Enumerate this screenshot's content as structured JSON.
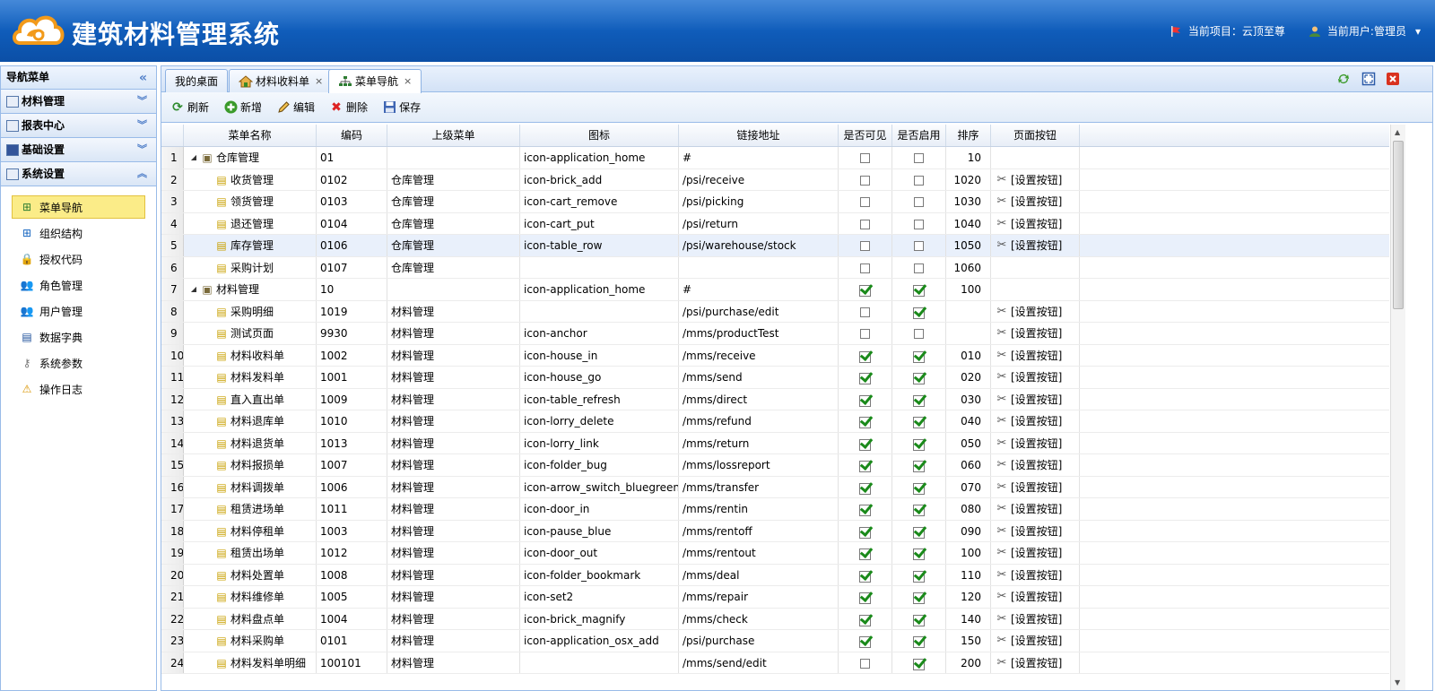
{
  "header": {
    "title": "建筑材料管理系统",
    "project_label": "当前项目：云顶至尊",
    "user_label": "当前用户:管理员",
    "user_dropdown": "▾"
  },
  "sidebar": {
    "title": "导航菜单",
    "collapse_glyph": "«",
    "groups": [
      {
        "label": "材料管理",
        "chevron": "︾"
      },
      {
        "label": "报表中心",
        "chevron": "︾"
      },
      {
        "label": "基础设置",
        "chevron": "︾"
      },
      {
        "label": "系统设置",
        "chevron": "︽"
      }
    ],
    "items": [
      {
        "label": "菜单导航",
        "icon": "sitemap-icon",
        "glyph": "⊞",
        "color": "#2e7d32"
      },
      {
        "label": "组织结构",
        "icon": "org-icon",
        "glyph": "⊞",
        "color": "#1565c0"
      },
      {
        "label": "授权代码",
        "icon": "lock-icon",
        "glyph": "🔒",
        "color": "#c28b00"
      },
      {
        "label": "角色管理",
        "icon": "role-icon",
        "glyph": "👥",
        "color": "#b04a00"
      },
      {
        "label": "用户管理",
        "icon": "users-icon",
        "glyph": "👥",
        "color": "#b04a00"
      },
      {
        "label": "数据字典",
        "icon": "book-icon",
        "glyph": "▤",
        "color": "#1a4d99"
      },
      {
        "label": "系统参数",
        "icon": "key-icon",
        "glyph": "⚷",
        "color": "#777"
      },
      {
        "label": "操作日志",
        "icon": "warning-icon",
        "glyph": "⚠",
        "color": "#d99400"
      }
    ]
  },
  "tabs": [
    {
      "label": "我的桌面",
      "closable": false
    },
    {
      "label": "材料收料单",
      "closable": true
    },
    {
      "label": "菜单导航",
      "closable": true
    }
  ],
  "tab_close_glyph": "×",
  "toolbar": {
    "refresh": "刷新",
    "add": "新增",
    "edit": "编辑",
    "delete": "删除",
    "save": "保存"
  },
  "grid": {
    "columns": [
      "菜单名称",
      "编码",
      "上级菜单",
      "图标",
      "链接地址",
      "是否可见",
      "是否启用",
      "排序",
      "页面按钮"
    ],
    "set_button_label": "[设置按钮]",
    "rows": [
      {
        "n": "1",
        "name": "仓库管理",
        "code": "01",
        "parent": "",
        "icon": "icon-application_home",
        "url": "#",
        "visible": false,
        "enabled": false,
        "sort": "10",
        "btn": false,
        "level": 0
      },
      {
        "n": "2",
        "name": "收货管理",
        "code": "0102",
        "parent": "仓库管理",
        "icon": "icon-brick_add",
        "url": "/psi/receive",
        "visible": false,
        "enabled": false,
        "sort": "1020",
        "btn": true,
        "level": 1
      },
      {
        "n": "3",
        "name": "领货管理",
        "code": "0103",
        "parent": "仓库管理",
        "icon": "icon-cart_remove",
        "url": "/psi/picking",
        "visible": false,
        "enabled": false,
        "sort": "1030",
        "btn": true,
        "level": 1
      },
      {
        "n": "4",
        "name": "退还管理",
        "code": "0104",
        "parent": "仓库管理",
        "icon": "icon-cart_put",
        "url": "/psi/return",
        "visible": false,
        "enabled": false,
        "sort": "1040",
        "btn": true,
        "level": 1
      },
      {
        "n": "5",
        "name": "库存管理",
        "code": "0106",
        "parent": "仓库管理",
        "icon": "icon-table_row",
        "url": "/psi/warehouse/stock",
        "visible": false,
        "enabled": false,
        "sort": "1050",
        "btn": true,
        "level": 1,
        "hl": true
      },
      {
        "n": "6",
        "name": "采购计划",
        "code": "0107",
        "parent": "仓库管理",
        "icon": "",
        "url": "",
        "visible": false,
        "enabled": false,
        "sort": "1060",
        "btn": false,
        "level": 1
      },
      {
        "n": "7",
        "name": "材料管理",
        "code": "10",
        "parent": "",
        "icon": "icon-application_home",
        "url": "#",
        "visible": true,
        "enabled": true,
        "sort": "100",
        "btn": false,
        "level": 0
      },
      {
        "n": "8",
        "name": "采购明细",
        "code": "1019",
        "parent": "材料管理",
        "icon": "",
        "url": "/psi/purchase/edit",
        "visible": false,
        "enabled": true,
        "sort": "",
        "btn": true,
        "level": 1
      },
      {
        "n": "9",
        "name": "测试页面",
        "code": "9930",
        "parent": "材料管理",
        "icon": "icon-anchor",
        "url": "/mms/productTest",
        "visible": false,
        "enabled": false,
        "sort": "",
        "btn": true,
        "level": 1
      },
      {
        "n": "10",
        "name": "材料收料单",
        "code": "1002",
        "parent": "材料管理",
        "icon": "icon-house_in",
        "url": "/mms/receive",
        "visible": true,
        "enabled": true,
        "sort": "010",
        "btn": true,
        "level": 1
      },
      {
        "n": "11",
        "name": "材料发料单",
        "code": "1001",
        "parent": "材料管理",
        "icon": "icon-house_go",
        "url": "/mms/send",
        "visible": true,
        "enabled": true,
        "sort": "020",
        "btn": true,
        "level": 1
      },
      {
        "n": "12",
        "name": "直入直出单",
        "code": "1009",
        "parent": "材料管理",
        "icon": "icon-table_refresh",
        "url": "/mms/direct",
        "visible": true,
        "enabled": true,
        "sort": "030",
        "btn": true,
        "level": 1
      },
      {
        "n": "13",
        "name": "材料退库单",
        "code": "1010",
        "parent": "材料管理",
        "icon": "icon-lorry_delete",
        "url": "/mms/refund",
        "visible": true,
        "enabled": true,
        "sort": "040",
        "btn": true,
        "level": 1
      },
      {
        "n": "14",
        "name": "材料退货单",
        "code": "1013",
        "parent": "材料管理",
        "icon": "icon-lorry_link",
        "url": "/mms/return",
        "visible": true,
        "enabled": true,
        "sort": "050",
        "btn": true,
        "level": 1
      },
      {
        "n": "15",
        "name": "材料报损单",
        "code": "1007",
        "parent": "材料管理",
        "icon": "icon-folder_bug",
        "url": "/mms/lossreport",
        "visible": true,
        "enabled": true,
        "sort": "060",
        "btn": true,
        "level": 1
      },
      {
        "n": "16",
        "name": "材料调拨单",
        "code": "1006",
        "parent": "材料管理",
        "icon": "icon-arrow_switch_bluegreen",
        "url": "/mms/transfer",
        "visible": true,
        "enabled": true,
        "sort": "070",
        "btn": true,
        "level": 1
      },
      {
        "n": "17",
        "name": "租赁进场单",
        "code": "1011",
        "parent": "材料管理",
        "icon": "icon-door_in",
        "url": "/mms/rentin",
        "visible": true,
        "enabled": true,
        "sort": "080",
        "btn": true,
        "level": 1
      },
      {
        "n": "18",
        "name": "材料停租单",
        "code": "1003",
        "parent": "材料管理",
        "icon": "icon-pause_blue",
        "url": "/mms/rentoff",
        "visible": true,
        "enabled": true,
        "sort": "090",
        "btn": true,
        "level": 1
      },
      {
        "n": "19",
        "name": "租赁出场单",
        "code": "1012",
        "parent": "材料管理",
        "icon": "icon-door_out",
        "url": "/mms/rentout",
        "visible": true,
        "enabled": true,
        "sort": "100",
        "btn": true,
        "level": 1
      },
      {
        "n": "20",
        "name": "材料处置单",
        "code": "1008",
        "parent": "材料管理",
        "icon": "icon-folder_bookmark",
        "url": "/mms/deal",
        "visible": true,
        "enabled": true,
        "sort": "110",
        "btn": true,
        "level": 1
      },
      {
        "n": "21",
        "name": "材料维修单",
        "code": "1005",
        "parent": "材料管理",
        "icon": "icon-set2",
        "url": "/mms/repair",
        "visible": true,
        "enabled": true,
        "sort": "120",
        "btn": true,
        "level": 1
      },
      {
        "n": "22",
        "name": "材料盘点单",
        "code": "1004",
        "parent": "材料管理",
        "icon": "icon-brick_magnify",
        "url": "/mms/check",
        "visible": true,
        "enabled": true,
        "sort": "140",
        "btn": true,
        "level": 1
      },
      {
        "n": "23",
        "name": "材料采购单",
        "code": "0101",
        "parent": "材料管理",
        "icon": "icon-application_osx_add",
        "url": "/psi/purchase",
        "visible": true,
        "enabled": true,
        "sort": "150",
        "btn": true,
        "level": 1
      },
      {
        "n": "24",
        "name": "材料发料单明细",
        "code": "100101",
        "parent": "材料管理",
        "icon": "",
        "url": "/mms/send/edit",
        "visible": false,
        "enabled": true,
        "sort": "200",
        "btn": true,
        "level": 1
      }
    ]
  }
}
